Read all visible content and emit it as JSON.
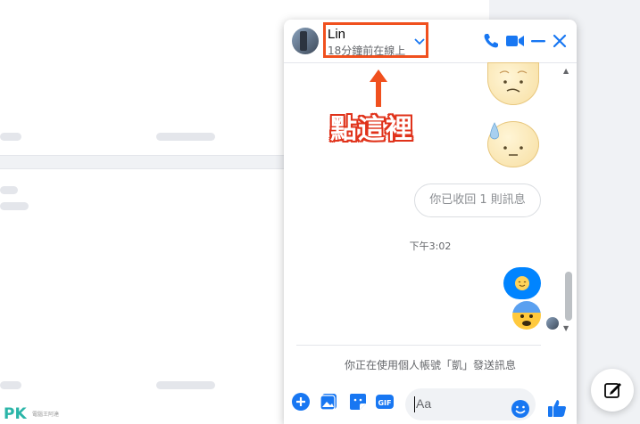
{
  "contact": {
    "name": "Lin",
    "status": "18分鐘前在線上"
  },
  "messages": {
    "retracted": "你已收回 1 則訊息",
    "time": "下午3:02"
  },
  "notice": "你正在使用個人帳號「凱」發送訊息",
  "composer": {
    "placeholder": "Aa"
  },
  "annotation": {
    "text": "點這裡"
  },
  "watermark": {
    "logo": "PK",
    "sub": "電腦王阿達"
  },
  "icons": {
    "header": [
      "phone-icon",
      "video-icon",
      "minimize-icon",
      "close-icon"
    ],
    "composer": [
      "plus-icon",
      "photo-icon",
      "sticker-icon",
      "gif-icon",
      "emoji-icon",
      "like-icon"
    ]
  },
  "colors": {
    "accent": "#1877f2",
    "bubble": "#0084ff",
    "annotation": "#f0501e"
  }
}
